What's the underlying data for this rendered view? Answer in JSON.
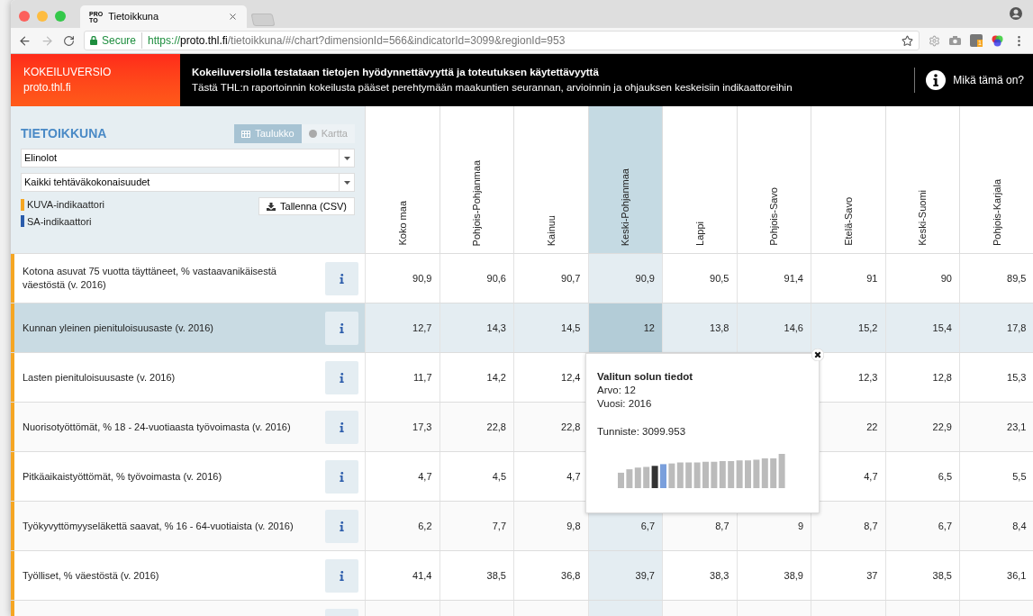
{
  "browser": {
    "tab_title": "Tietoikkuna",
    "favicon_lines": [
      "PRO",
      "TO"
    ],
    "secure_label": "Secure",
    "url_scheme": "https://",
    "url_host": "proto.thl.fi",
    "url_path": "/tietoikkuna/#/chart?dimensionId=566&indicatorId=3099&regionId=953",
    "extension_badge": "1"
  },
  "banner": {
    "badge_title": "KOKEILUVERSIO",
    "badge_site": "proto.thl.fi",
    "headline": "Kokeiluversiolla testataan tietojen hyödynnettävyyttä ja toteutuksen käytettävyyttä",
    "subline": "Tästä THL:n raportoinnin kokeilusta pääset perehtymään maakuntien seurannan, arvioinnin ja ohjauksen keskeisiin indikaattoreihin",
    "help": "Mikä tämä on?"
  },
  "sidebar": {
    "title": "TIETOIKKUNA",
    "view_tabs": [
      {
        "label": "Taulukko",
        "kind": "table",
        "selected": true
      },
      {
        "label": "Kartta",
        "kind": "map",
        "selected": false
      }
    ],
    "selects": [
      {
        "value": "Elinolot"
      },
      {
        "value": "Kaikki tehtäväkokonaisuudet"
      }
    ],
    "legend": [
      {
        "label": "KUVA-indikaattori",
        "color": "#f5a623"
      },
      {
        "label": "SA-indikaattori",
        "color": "#2b5cab"
      }
    ],
    "save_button": "Tallenna (CSV)"
  },
  "table": {
    "columns": [
      {
        "label": "Koko maa",
        "selected": false
      },
      {
        "label": "Pohjois-Pohjanmaa",
        "selected": false
      },
      {
        "label": "Kainuu",
        "selected": false
      },
      {
        "label": "Keski-Pohjanmaa",
        "selected": true
      },
      {
        "label": "Lappi",
        "selected": false
      },
      {
        "label": "Pohjois-Savo",
        "selected": false
      },
      {
        "label": "Etelä-Savo",
        "selected": false
      },
      {
        "label": "Keski-Suomi",
        "selected": false
      },
      {
        "label": "Pohjois-Karjala",
        "selected": false
      }
    ],
    "rows": [
      {
        "label": "Kotona asuvat 75 vuotta täyttäneet, % vastaavanikäisestä väestöstä (v. 2016)",
        "color": "#f5a623",
        "selected": false,
        "values": [
          "90,9",
          "90,6",
          "90,7",
          "90,9",
          "90,5",
          "91,4",
          "91",
          "90",
          "89,5"
        ]
      },
      {
        "label": "Kunnan yleinen pienituloisuusaste (v. 2016)",
        "color": "#f5a623",
        "selected": true,
        "values": [
          "12,7",
          "14,3",
          "14,5",
          "12",
          "13,8",
          "14,6",
          "15,2",
          "15,4",
          "17,8"
        ]
      },
      {
        "label": "Lasten pienituloisuusaste (v. 2016)",
        "color": "#f5a623",
        "selected": false,
        "values": [
          "11,7",
          "14,2",
          "12,4"
        ],
        "values_after_popup": [
          "12,3",
          "12,8",
          "15,3"
        ]
      },
      {
        "label": "Nuorisotyöttömät, % 18 - 24-vuotiaasta työvoimasta (v. 2016)",
        "color": "#f5a623",
        "selected": false,
        "values": [
          "17,3",
          "22,8",
          "22,8"
        ],
        "values_after_popup": [
          "22",
          "22,9",
          "23,1"
        ]
      },
      {
        "label": "Pitkäaikaistyöttömät, % työvoimasta (v. 2016)",
        "color": "#f5a623",
        "selected": false,
        "values": [
          "4,7",
          "4,5",
          "4,7"
        ],
        "values_after_popup": [
          "4,7",
          "6,5",
          "5,5"
        ]
      },
      {
        "label": "Työkyvyttömyyseläkettä saavat, % 16 - 64-vuotiaista (v. 2016)",
        "color": "#f5a623",
        "selected": false,
        "values": [
          "6,2",
          "7,7",
          "9,8",
          "6,7",
          "8,7",
          "9",
          "8,7",
          "6,7",
          "8,4"
        ]
      },
      {
        "label": "Työlliset, % väestöstä (v. 2016)",
        "color": "#f5a623",
        "selected": false,
        "values": [
          "41,4",
          "38,5",
          "36,8",
          "39,7",
          "38,3",
          "38,9",
          "37",
          "38,5",
          "36,1"
        ]
      },
      {
        "color": "#f5a623",
        "selected": false
      }
    ]
  },
  "tooltip": {
    "title": "Valitun solun tiedot",
    "lines": [
      "Arvo: 12",
      "Vuosi: 2016"
    ],
    "id_line": "Tunniste: 3099.953"
  }
}
